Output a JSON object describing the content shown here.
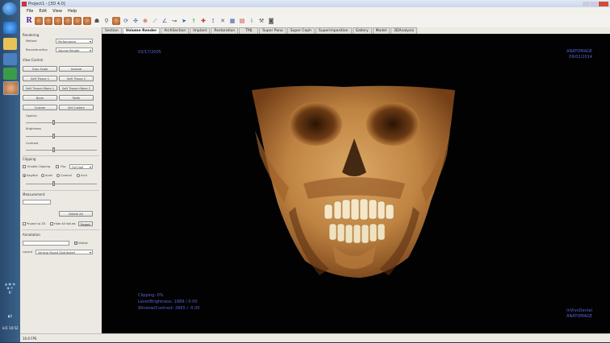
{
  "window": {
    "title": "Project1 - [3D 4.0]"
  },
  "menu": [
    "File",
    "Edit",
    "View",
    "Help"
  ],
  "toolbar": {
    "logo_letter": "R"
  },
  "tabs": [
    {
      "label": "Section"
    },
    {
      "label": "Volume Render",
      "active": true
    },
    {
      "label": "ArchSection"
    },
    {
      "label": "Implant"
    },
    {
      "label": "Restoration"
    },
    {
      "label": "TMJ"
    },
    {
      "label": "Super Pano"
    },
    {
      "label": "Super Ceph"
    },
    {
      "label": "Superimposition"
    },
    {
      "label": "Gallery"
    },
    {
      "label": "Model"
    },
    {
      "label": "3DAnalysis"
    }
  ],
  "panel": {
    "rendering": {
      "heading": "Rendering",
      "method_label": "Method",
      "method_value": "Performance",
      "reconstruction_label": "Reconstruction",
      "reconstruction_value": "Volume Render"
    },
    "view_control": {
      "heading": "View Control",
      "buttons": [
        "Gray Scale",
        "Inverse",
        "Soft Tissue 1",
        "Soft Tissue 2",
        "Soft Tissue+Bone 1",
        "Soft Tissue+Bone 2",
        "Bone",
        "Teeth",
        "Custom",
        "Set Custom"
      ],
      "opacity": "Opacity",
      "brightness": "Brightness",
      "contrast": "Contrast"
    },
    "clipping": {
      "heading": "Clipping",
      "enable": "Enable Clipping",
      "flip": "Flip",
      "half_value": "Full Half",
      "radios": [
        "Sagittal",
        "Axial",
        "Coronal",
        "Arch"
      ]
    },
    "measurement": {
      "heading": "Measurement",
      "delete_all": "Delete All",
      "project_2d": "Project to 2D",
      "hide_all": "Hide All Values",
      "report": "Report"
    },
    "annotation": {
      "heading": "Annotation",
      "visible": "Visible"
    },
    "layout": {
      "label": "Layout",
      "value": "Vertical Round Distributed"
    }
  },
  "overlay": {
    "top_left_date": "03/17/2005",
    "top_right_brand": "ANATOMAGE",
    "top_right_date": "09/02/2014",
    "clipping": "Clipping:  0%",
    "level": "Level/Brightness:  1889 / 0.00",
    "window": "Window/Contrast:  2665 / -0.00",
    "bottom_right_1": "InVivoDental",
    "bottom_right_2": "ANATOMAGE"
  },
  "status": {
    "fps": "10.6 FPS"
  },
  "taskbar": {
    "clock": "오후 10:52"
  },
  "colors": {
    "overlay_text": "#5b64d8",
    "bone": "#d9a15e",
    "viewport_bg": "#020202"
  }
}
